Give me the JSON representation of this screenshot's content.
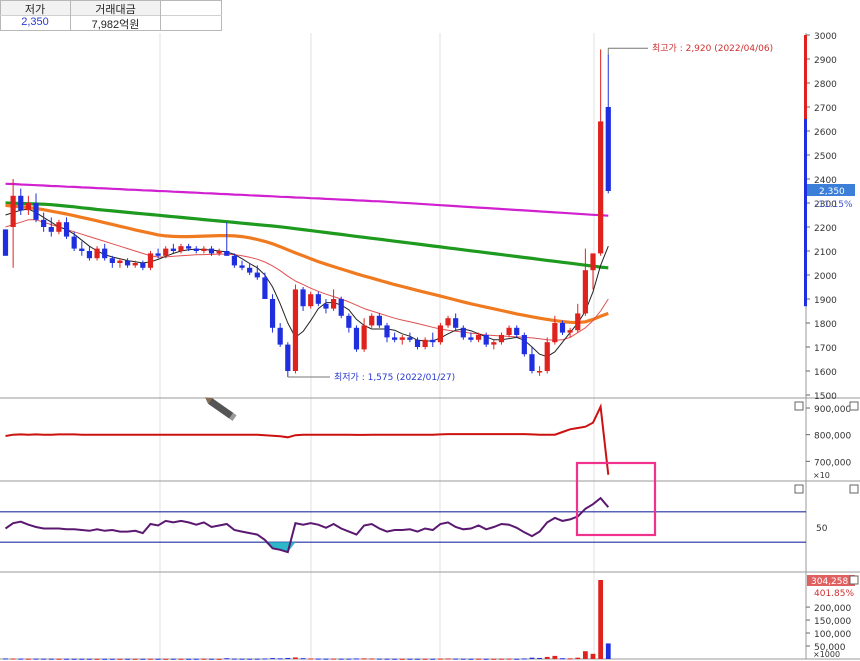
{
  "header": {
    "col1_label": "저가",
    "col1_value": "2,350",
    "col2_label": "거래대금",
    "col2_value": "7,982억원"
  },
  "colors": {
    "up": "#e0221f",
    "down": "#1f2fe0",
    "ma_long": "#d020d0",
    "ma_120": "#1e9a1e",
    "ma_60": "#f07a20",
    "ma_20": "#e05050",
    "ma_5": "#222222",
    "highlight": "#f0328c",
    "rsi_line": "#5a1870",
    "rsi_fill": "#2cb8c8",
    "obv_line": "#cc1111",
    "guide": "#2030a0",
    "price_tag_bg": "#3b7fd8"
  },
  "chart_data": [
    {
      "type": "candlestick",
      "name": "price",
      "yticks": [
        1500,
        1600,
        1700,
        1800,
        1900,
        2000,
        2100,
        2200,
        2300,
        2400,
        2500,
        2600,
        2700,
        2800,
        2900,
        3000
      ],
      "ylim": [
        1500,
        3000
      ],
      "current_price_label": "2,350",
      "current_change_label": "-11.15%",
      "high_annotation": "최고가 : 2,920 (2022/04/06)",
      "low_annotation": "최저가 : 1,575 (2022/01/27)",
      "candles": [
        [
          2190,
          2190,
          2080,
          2080
        ],
        [
          2200,
          2400,
          2030,
          2330
        ],
        [
          2330,
          2360,
          2250,
          2270
        ],
        [
          2270,
          2330,
          2250,
          2300
        ],
        [
          2300,
          2340,
          2220,
          2230
        ],
        [
          2230,
          2260,
          2180,
          2200
        ],
        [
          2200,
          2240,
          2160,
          2180
        ],
        [
          2180,
          2230,
          2170,
          2220
        ],
        [
          2220,
          2240,
          2150,
          2160
        ],
        [
          2160,
          2180,
          2100,
          2110
        ],
        [
          2110,
          2140,
          2080,
          2100
        ],
        [
          2100,
          2120,
          2060,
          2070
        ],
        [
          2070,
          2120,
          2060,
          2110
        ],
        [
          2110,
          2130,
          2060,
          2070
        ],
        [
          2070,
          2080,
          2030,
          2050
        ],
        [
          2050,
          2070,
          2030,
          2060
        ],
        [
          2060,
          2070,
          2030,
          2040
        ],
        [
          2040,
          2060,
          2030,
          2050
        ],
        [
          2050,
          2060,
          2020,
          2030
        ],
        [
          2030,
          2100,
          2020,
          2090
        ],
        [
          2090,
          2110,
          2070,
          2080
        ],
        [
          2080,
          2120,
          2070,
          2110
        ],
        [
          2110,
          2130,
          2090,
          2100
        ],
        [
          2100,
          2130,
          2090,
          2120
        ],
        [
          2120,
          2130,
          2100,
          2110
        ],
        [
          2110,
          2120,
          2090,
          2100
        ],
        [
          2100,
          2120,
          2090,
          2110
        ],
        [
          2110,
          2120,
          2080,
          2090
        ],
        [
          2090,
          2110,
          2080,
          2100
        ],
        [
          2100,
          2220,
          2080,
          2080
        ],
        [
          2080,
          2090,
          2030,
          2040
        ],
        [
          2040,
          2060,
          2020,
          2030
        ],
        [
          2030,
          2050,
          2000,
          2010
        ],
        [
          2010,
          2040,
          1980,
          1990
        ],
        [
          1990,
          2010,
          1900,
          1900
        ],
        [
          1900,
          1920,
          1760,
          1780
        ],
        [
          1780,
          1800,
          1700,
          1710
        ],
        [
          1710,
          1720,
          1575,
          1600
        ],
        [
          1600,
          1960,
          1590,
          1940
        ],
        [
          1940,
          1950,
          1850,
          1870
        ],
        [
          1870,
          1930,
          1860,
          1920
        ],
        [
          1920,
          1930,
          1870,
          1880
        ],
        [
          1880,
          1900,
          1840,
          1860
        ],
        [
          1860,
          1940,
          1850,
          1900
        ],
        [
          1900,
          1910,
          1820,
          1830
        ],
        [
          1830,
          1840,
          1760,
          1780
        ],
        [
          1780,
          1790,
          1680,
          1690
        ],
        [
          1690,
          1820,
          1680,
          1790
        ],
        [
          1790,
          1840,
          1780,
          1830
        ],
        [
          1830,
          1840,
          1780,
          1790
        ],
        [
          1790,
          1800,
          1720,
          1740
        ],
        [
          1740,
          1760,
          1720,
          1730
        ],
        [
          1730,
          1750,
          1710,
          1740
        ],
        [
          1740,
          1760,
          1720,
          1730
        ],
        [
          1730,
          1740,
          1690,
          1700
        ],
        [
          1700,
          1740,
          1690,
          1730
        ],
        [
          1730,
          1760,
          1700,
          1720
        ],
        [
          1720,
          1800,
          1710,
          1790
        ],
        [
          1790,
          1830,
          1780,
          1820
        ],
        [
          1820,
          1840,
          1770,
          1780
        ],
        [
          1780,
          1790,
          1730,
          1740
        ],
        [
          1740,
          1760,
          1720,
          1730
        ],
        [
          1730,
          1760,
          1720,
          1750
        ],
        [
          1750,
          1760,
          1700,
          1710
        ],
        [
          1710,
          1730,
          1690,
          1720
        ],
        [
          1720,
          1760,
          1710,
          1750
        ],
        [
          1750,
          1790,
          1740,
          1780
        ],
        [
          1780,
          1790,
          1740,
          1750
        ],
        [
          1750,
          1760,
          1660,
          1670
        ],
        [
          1670,
          1700,
          1590,
          1600
        ],
        [
          1600,
          1620,
          1580,
          1600
        ],
        [
          1600,
          1740,
          1590,
          1720
        ],
        [
          1720,
          1830,
          1710,
          1800
        ],
        [
          1800,
          1810,
          1750,
          1760
        ],
        [
          1760,
          1780,
          1740,
          1770
        ],
        [
          1770,
          1880,
          1760,
          1840
        ],
        [
          1840,
          2110,
          1830,
          2020
        ],
        [
          2020,
          2040,
          1940,
          2090
        ],
        [
          2090,
          2940,
          2080,
          2640
        ],
        [
          2700,
          2920,
          2340,
          2350
        ]
      ],
      "ma_long": [
        2380,
        2379,
        2377,
        2376,
        2374,
        2373,
        2371,
        2370,
        2368,
        2367,
        2365,
        2364,
        2362,
        2361,
        2359,
        2358,
        2356,
        2355,
        2353,
        2352,
        2350,
        2349,
        2347,
        2346,
        2344,
        2343,
        2341,
        2340,
        2338,
        2337,
        2335,
        2334,
        2332,
        2331,
        2329,
        2328,
        2326,
        2325,
        2323,
        2322,
        2320,
        2319,
        2317,
        2316,
        2314,
        2313,
        2311,
        2310,
        2308,
        2307,
        2305,
        2303,
        2301,
        2299,
        2297,
        2295,
        2293,
        2291,
        2289,
        2287,
        2285,
        2283,
        2281,
        2279,
        2277,
        2275,
        2273,
        2271,
        2269,
        2267,
        2265,
        2263,
        2261,
        2259,
        2257,
        2255,
        2253,
        2251,
        2249,
        2247
      ],
      "ma_120": [
        2300,
        2299,
        2298,
        2297,
        2296,
        2295,
        2293,
        2290,
        2287,
        2284,
        2280,
        2277,
        2273,
        2270,
        2267,
        2264,
        2261,
        2258,
        2255,
        2252,
        2249,
        2246,
        2243,
        2240,
        2237,
        2234,
        2231,
        2228,
        2225,
        2222,
        2219,
        2216,
        2213,
        2210,
        2207,
        2204,
        2201,
        2197,
        2193,
        2189,
        2185,
        2181,
        2177,
        2173,
        2169,
        2165,
        2161,
        2157,
        2153,
        2149,
        2145,
        2141,
        2137,
        2133,
        2129,
        2125,
        2121,
        2117,
        2113,
        2109,
        2105,
        2101,
        2097,
        2093,
        2089,
        2085,
        2081,
        2077,
        2073,
        2069,
        2065,
        2061,
        2057,
        2053,
        2049,
        2045,
        2041,
        2037,
        2033,
        2030
      ],
      "ma_60": [
        2290,
        2287,
        2284,
        2281,
        2277,
        2272,
        2266,
        2260,
        2254,
        2247,
        2240,
        2233,
        2226,
        2218,
        2211,
        2203,
        2196,
        2188,
        2181,
        2174,
        2167,
        2163,
        2161,
        2160,
        2160,
        2161,
        2162,
        2163,
        2164,
        2164,
        2163,
        2160,
        2155,
        2148,
        2140,
        2130,
        2118,
        2105,
        2092,
        2080,
        2068,
        2056,
        2045,
        2035,
        2025,
        2015,
        2005,
        1996,
        1987,
        1978,
        1969,
        1960,
        1952,
        1944,
        1936,
        1928,
        1920,
        1912,
        1904,
        1896,
        1888,
        1880,
        1873,
        1866,
        1859,
        1852,
        1845,
        1838,
        1832,
        1826,
        1820,
        1815,
        1810,
        1806,
        1803,
        1802,
        1805,
        1815,
        1828,
        1840
      ],
      "ma_20": [
        2200,
        2210,
        2220,
        2230,
        2230,
        2220,
        2210,
        2200,
        2190,
        2180,
        2170,
        2160,
        2150,
        2140,
        2130,
        2120,
        2110,
        2100,
        2090,
        2080,
        2075,
        2075,
        2078,
        2080,
        2082,
        2084,
        2085,
        2086,
        2087,
        2087,
        2085,
        2080,
        2074,
        2066,
        2054,
        2038,
        2018,
        1995,
        1975,
        1960,
        1945,
        1932,
        1920,
        1910,
        1900,
        1888,
        1874,
        1860,
        1850,
        1840,
        1830,
        1820,
        1812,
        1805,
        1798,
        1790,
        1782,
        1775,
        1770,
        1766,
        1762,
        1758,
        1754,
        1750,
        1748,
        1746,
        1744,
        1742,
        1740,
        1738,
        1734,
        1730,
        1728,
        1730,
        1740,
        1760,
        1780,
        1810,
        1850,
        1900
      ],
      "ma_5": [
        2250,
        2260,
        2270,
        2275,
        2260,
        2240,
        2220,
        2200,
        2190,
        2170,
        2145,
        2120,
        2100,
        2085,
        2075,
        2068,
        2060,
        2055,
        2050,
        2055,
        2065,
        2078,
        2090,
        2100,
        2105,
        2108,
        2106,
        2104,
        2100,
        2096,
        2086,
        2068,
        2048,
        2030,
        2000,
        1950,
        1880,
        1800,
        1740,
        1765,
        1810,
        1860,
        1885,
        1885,
        1875,
        1855,
        1815,
        1790,
        1775,
        1775,
        1775,
        1770,
        1755,
        1745,
        1728,
        1725,
        1725,
        1738,
        1755,
        1770,
        1775,
        1768,
        1755,
        1742,
        1730,
        1730,
        1735,
        1740,
        1728,
        1700,
        1670,
        1660,
        1680,
        1720,
        1760,
        1800,
        1850,
        1930,
        2040,
        2120
      ]
    },
    {
      "type": "line",
      "name": "volume-indicator",
      "yticks": [
        700000,
        800000,
        900000
      ],
      "ylim": [
        630000,
        930000
      ],
      "unit_label": "×10",
      "values": [
        795000,
        800000,
        801000,
        800000,
        801000,
        800000,
        800000,
        801000,
        801000,
        801000,
        800000,
        800000,
        800000,
        800000,
        800000,
        800000,
        800000,
        800000,
        800000,
        800000,
        800000,
        800000,
        800000,
        800000,
        800000,
        800000,
        800000,
        800000,
        800000,
        800000,
        800000,
        800000,
        800000,
        800000,
        798000,
        796000,
        794000,
        790000,
        798000,
        800000,
        800000,
        800000,
        800000,
        800000,
        800000,
        800000,
        799000,
        799000,
        800000,
        800000,
        800000,
        800000,
        800000,
        800000,
        800000,
        800000,
        800000,
        801000,
        802000,
        802000,
        802000,
        802000,
        802000,
        802000,
        802000,
        802000,
        802000,
        802000,
        802000,
        801000,
        800000,
        800000,
        800000,
        810000,
        820000,
        825000,
        830000,
        845000,
        905000,
        650000
      ]
    },
    {
      "type": "line",
      "name": "rsi",
      "yticks": [
        50
      ],
      "guide_levels": [
        70,
        30
      ],
      "ylim": [
        0,
        100
      ],
      "values": [
        48,
        55,
        57,
        53,
        50,
        48,
        48,
        48,
        47,
        47,
        46,
        45,
        47,
        45,
        46,
        44,
        44,
        45,
        42,
        54,
        52,
        58,
        56,
        58,
        56,
        53,
        56,
        50,
        52,
        54,
        46,
        44,
        42,
        40,
        33,
        22,
        20,
        17,
        55,
        53,
        55,
        53,
        49,
        54,
        48,
        44,
        40,
        52,
        54,
        48,
        44,
        46,
        46,
        47,
        44,
        48,
        46,
        54,
        56,
        50,
        47,
        48,
        52,
        47,
        50,
        54,
        53,
        49,
        43,
        38,
        44,
        56,
        62,
        58,
        60,
        64,
        74,
        80,
        88,
        76
      ]
    },
    {
      "type": "bar",
      "name": "volume",
      "yticks": [
        50000,
        100000,
        150000,
        200000
      ],
      "ylim": [
        0,
        304258
      ],
      "volume_label": "304,258",
      "change_label": "401.85%",
      "unit_label": "×1000",
      "values": [
        2000,
        1800,
        1500,
        1200,
        1500,
        1300,
        1200,
        1000,
        900,
        900,
        1000,
        900,
        800,
        800,
        900,
        800,
        900,
        800,
        900,
        1000,
        900,
        800,
        1000,
        900,
        800,
        900,
        1000,
        900,
        800,
        3000,
        1500,
        1200,
        1000,
        1200,
        2000,
        3500,
        2500,
        4000,
        6000,
        3000,
        2000,
        1500,
        1200,
        1500,
        1300,
        1400,
        2000,
        2500,
        2000,
        1500,
        1200,
        1000,
        900,
        1000,
        900,
        1000,
        900,
        1500,
        2000,
        1500,
        1200,
        1000,
        1100,
        1000,
        900,
        1200,
        1500,
        1000,
        2000,
        5000,
        4000,
        8000,
        12000,
        3000,
        2500,
        5000,
        30000,
        20000,
        304258,
        60000
      ],
      "up_flags": [
        0,
        1,
        0,
        1,
        0,
        0,
        0,
        1,
        0,
        0,
        0,
        0,
        1,
        0,
        0,
        1,
        0,
        1,
        0,
        1,
        0,
        1,
        0,
        1,
        0,
        0,
        1,
        0,
        1,
        0,
        0,
        0,
        0,
        0,
        0,
        0,
        0,
        0,
        1,
        0,
        1,
        0,
        0,
        1,
        0,
        0,
        0,
        1,
        1,
        0,
        0,
        0,
        1,
        0,
        0,
        1,
        0,
        1,
        1,
        0,
        0,
        0,
        1,
        0,
        1,
        1,
        1,
        0,
        0,
        0,
        0,
        1,
        1,
        0,
        1,
        1,
        1,
        1,
        1,
        0
      ]
    }
  ]
}
